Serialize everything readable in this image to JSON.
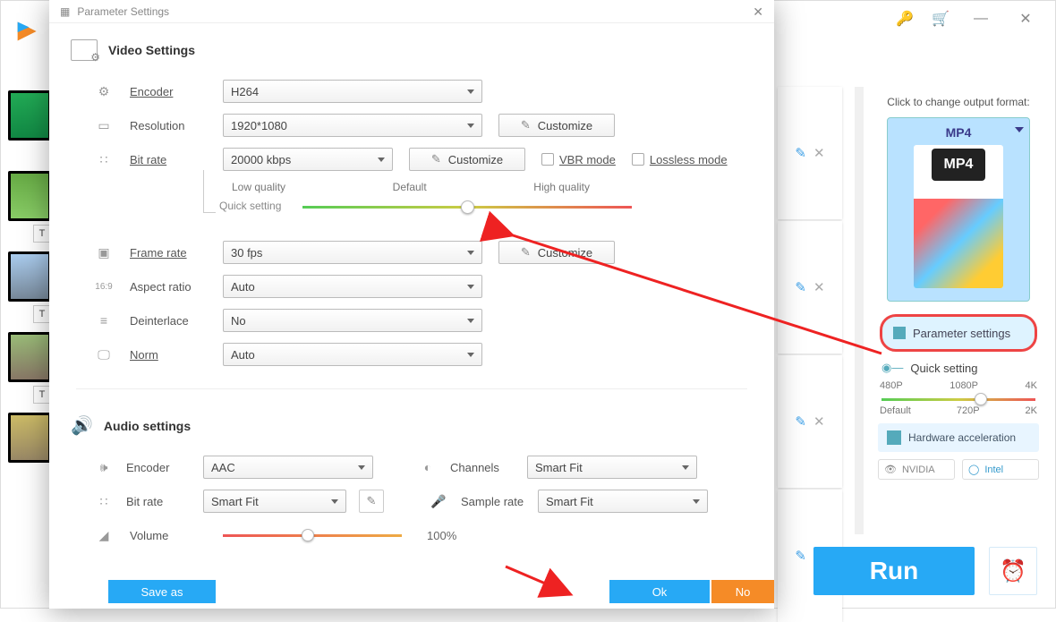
{
  "mainTitlebar": {
    "minimize": "—",
    "close": "✕"
  },
  "rightPanel": {
    "hint": "Click to change output format:",
    "formatLabel": "MP4",
    "mp4Badge": "MP4",
    "parameterBtn": "Parameter settings",
    "quickSetting": "Quick setting",
    "qsTicks": {
      "a": "480P",
      "b": "1080P",
      "c": "4K",
      "d": "Default",
      "e": "720P",
      "f": "2K"
    },
    "hwa": "Hardware acceleration",
    "nvidia": "NVIDIA",
    "intel": "Intel"
  },
  "runBtn": "Run",
  "dialog": {
    "title": "Parameter Settings",
    "video": {
      "header": "Video Settings",
      "encoderLabel": "Encoder",
      "encoderValue": "H264",
      "resolutionLabel": "Resolution",
      "resolutionValue": "1920*1080",
      "customize": "Customize",
      "bitrateLabel": "Bit rate",
      "bitrateValue": "20000 kbps",
      "vbr": "VBR mode",
      "lossless": "Lossless mode",
      "qsLabel": "Quick setting",
      "qLow": "Low quality",
      "qDefault": "Default",
      "qHigh": "High quality",
      "framerateLabel": "Frame rate",
      "framerateValue": "30 fps",
      "aspectLabel": "Aspect ratio",
      "aspectValue": "Auto",
      "deinterlaceLabel": "Deinterlace",
      "deinterlaceValue": "No",
      "normLabel": "Norm",
      "normValue": "Auto"
    },
    "audio": {
      "header": "Audio settings",
      "encoderLabel": "Encoder",
      "encoderValue": "AAC",
      "channelsLabel": "Channels",
      "channelsValue": "Smart Fit",
      "bitrateLabel": "Bit rate",
      "bitrateValue": "Smart Fit",
      "samplerateLabel": "Sample rate",
      "samplerateValue": "Smart Fit",
      "volumeLabel": "Volume",
      "volumeValue": "100%"
    },
    "footer": {
      "save": "Save as",
      "ok": "Ok",
      "no": "No"
    }
  }
}
